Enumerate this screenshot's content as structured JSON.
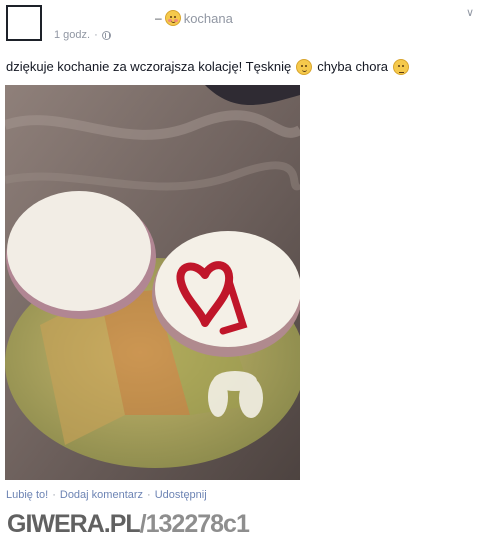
{
  "post": {
    "author_prefix": "–",
    "author_name": "kochana",
    "author_emoji": "blushing-face-icon",
    "timestamp": "1 godz.",
    "separator": "·",
    "privacy_icon": "globe-icon",
    "message_part1": "dziękuje kochanie za wczorajsza kolację! Tęsknię",
    "message_part2": "chyba chora",
    "emoji_1": "winking-face-icon",
    "emoji_2": "neutral-face-icon",
    "photo_icon": "sandwich-heart-ketchup-photo"
  },
  "actions": {
    "like": "Lubię to!",
    "comment": "Dodaj komentarz",
    "share": "Udostępnij",
    "separator": "·"
  },
  "watermark": {
    "site": "GIWERA.PL",
    "id": "/132278c1"
  },
  "colors": {
    "link": "#6d84b4",
    "meta": "#9197a3",
    "text": "#141823",
    "emoji_yellow": "#f5c94c",
    "ketchup": "#c0162a"
  }
}
